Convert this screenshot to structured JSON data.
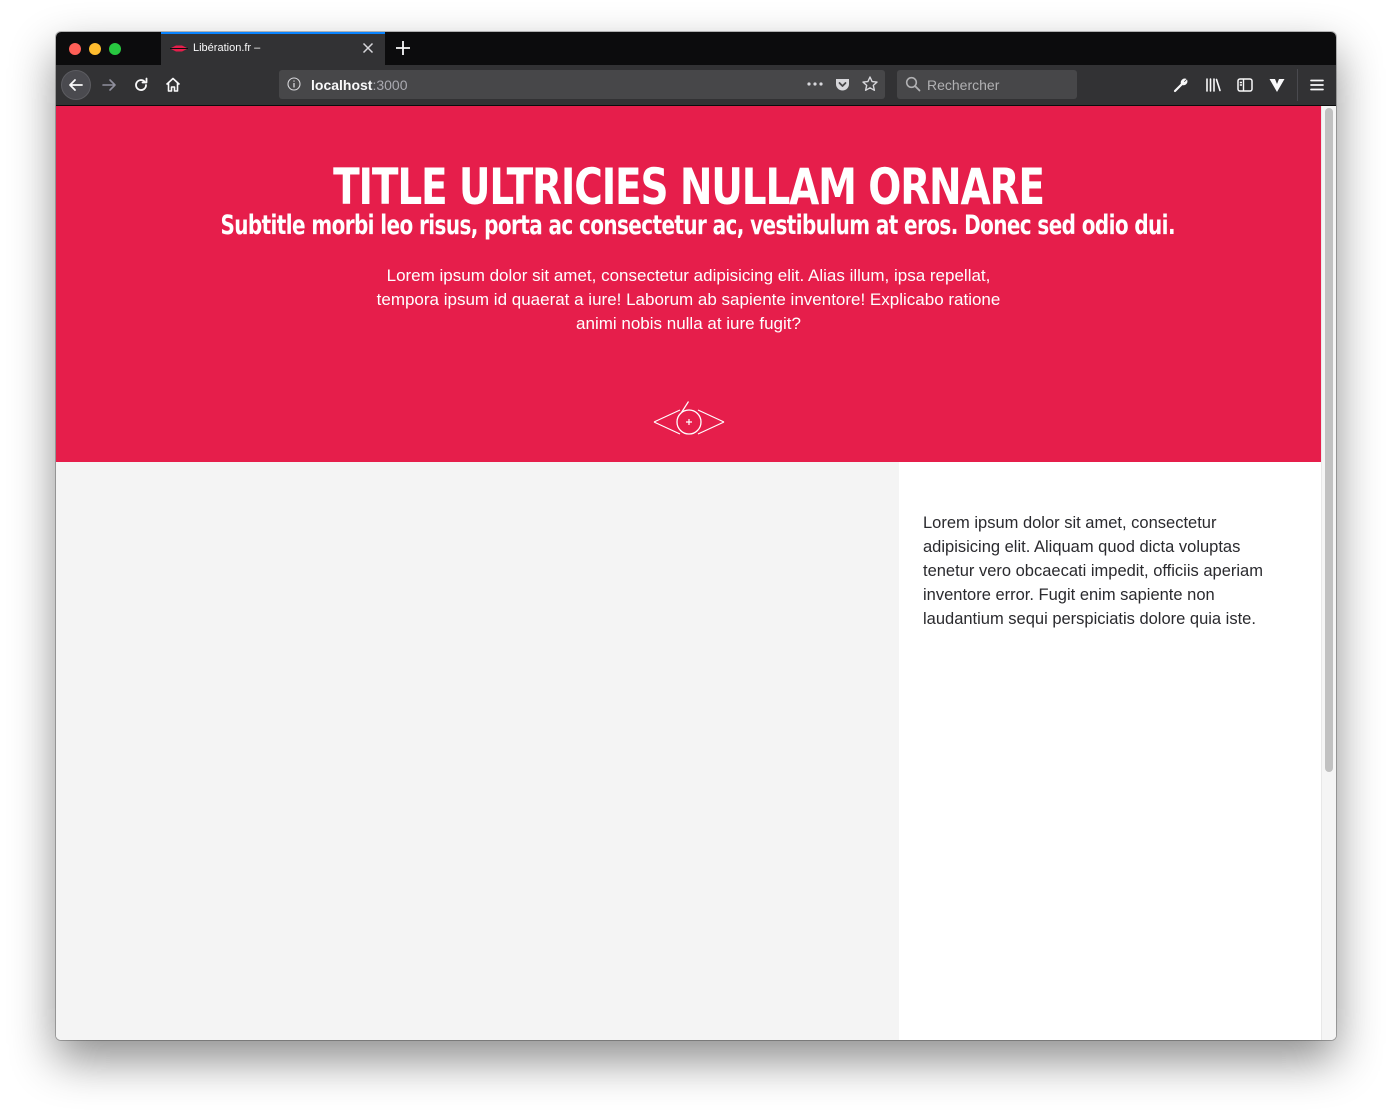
{
  "browser": {
    "tab_title": "Libération.fr –",
    "url_host": "localhost",
    "url_port": ":3000",
    "search_placeholder": "Rechercher"
  },
  "hero": {
    "title": "TITLE ULTRICIES NULLAM ORNARE",
    "subtitle": "Subtitle morbi leo risus, porta ac consectetur ac, vestibulum at eros. Donec sed odio dui.",
    "intro": "Lorem ipsum dolor sit amet, consectetur adipisicing elit. Alias illum, ipsa repellat, tempora ipsum id quaerat a iure! Laborum ab sapiente inventore! Explicabo ratione animi nobis nulla at iure fugit?",
    "background_color": "#e61e4b"
  },
  "sidebar": {
    "text": "Lorem ipsum dolor sit amet, consectetur adipisicing elit. Aliquam quod dicta voluptas tenetur vero obcaecati impedit, officiis aperiam inventore error. Fugit enim sapiente non laudantium sequi perspiciatis dolore quia iste."
  },
  "icons": {
    "favicon": "liberation-favicon",
    "tab_close": "close-icon",
    "new_tab": "plus-icon",
    "back": "arrow-left-icon",
    "forward": "arrow-right-icon",
    "reload": "reload-icon",
    "home": "home-icon",
    "site_info": "info-icon",
    "page_actions": "more-dots-icon",
    "pocket": "pocket-icon",
    "bookmark": "star-icon",
    "search": "search-icon",
    "devtools": "wrench-icon",
    "library": "library-icon",
    "sidebar_toggle": "sidebar-icon",
    "extension": "vivaldi-icon",
    "menu": "hamburger-menu-icon",
    "hero_logo": "eye-logo-icon"
  }
}
